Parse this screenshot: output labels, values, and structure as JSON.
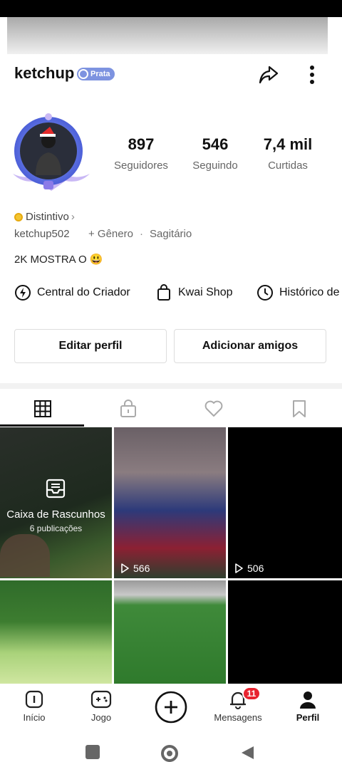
{
  "header": {
    "username": "ketchup",
    "badge_label": "Prata"
  },
  "stats": [
    {
      "value": "897",
      "label": "Seguidores"
    },
    {
      "value": "546",
      "label": "Seguindo"
    },
    {
      "value": "7,4 mil",
      "label": "Curtidas"
    }
  ],
  "profile": {
    "distintivo": "Distintivo",
    "handle": "ketchup502",
    "genero": "+ Gênero",
    "signo": "Sagitário",
    "bio": "2K MOSTRA O 😃"
  },
  "links": [
    {
      "label": "Central do Criador",
      "icon": "lightning-icon"
    },
    {
      "label": "Kwai Shop",
      "icon": "shopping-bag-icon"
    },
    {
      "label": "Histórico de",
      "icon": "clock-icon"
    }
  ],
  "actions": {
    "edit_label": "Editar perfil",
    "add_friends_label": "Adicionar amigos"
  },
  "tabs": [
    {
      "name": "grid",
      "icon": "grid-icon",
      "active": true
    },
    {
      "name": "private",
      "icon": "lock-icon"
    },
    {
      "name": "liked",
      "icon": "heart-icon"
    },
    {
      "name": "saved",
      "icon": "bookmark-icon"
    }
  ],
  "drafts": {
    "title": "Caixa de Rascunhos",
    "count_label": "6 publicações"
  },
  "videos": [
    {
      "views": "566"
    },
    {
      "views": "506"
    }
  ],
  "bottom_nav": [
    {
      "label": "Início",
      "icon": "home-icon"
    },
    {
      "label": "Jogo",
      "icon": "gamepad-icon"
    },
    {
      "label": "",
      "icon": "plus-icon"
    },
    {
      "label": "Mensagens",
      "icon": "bell-icon",
      "badge": "11"
    },
    {
      "label": "Perfil",
      "icon": "person-icon",
      "active": true
    }
  ],
  "colors": {
    "accent": "#e8232f",
    "badge": "#7d93e0",
    "border": "#dddddd"
  }
}
